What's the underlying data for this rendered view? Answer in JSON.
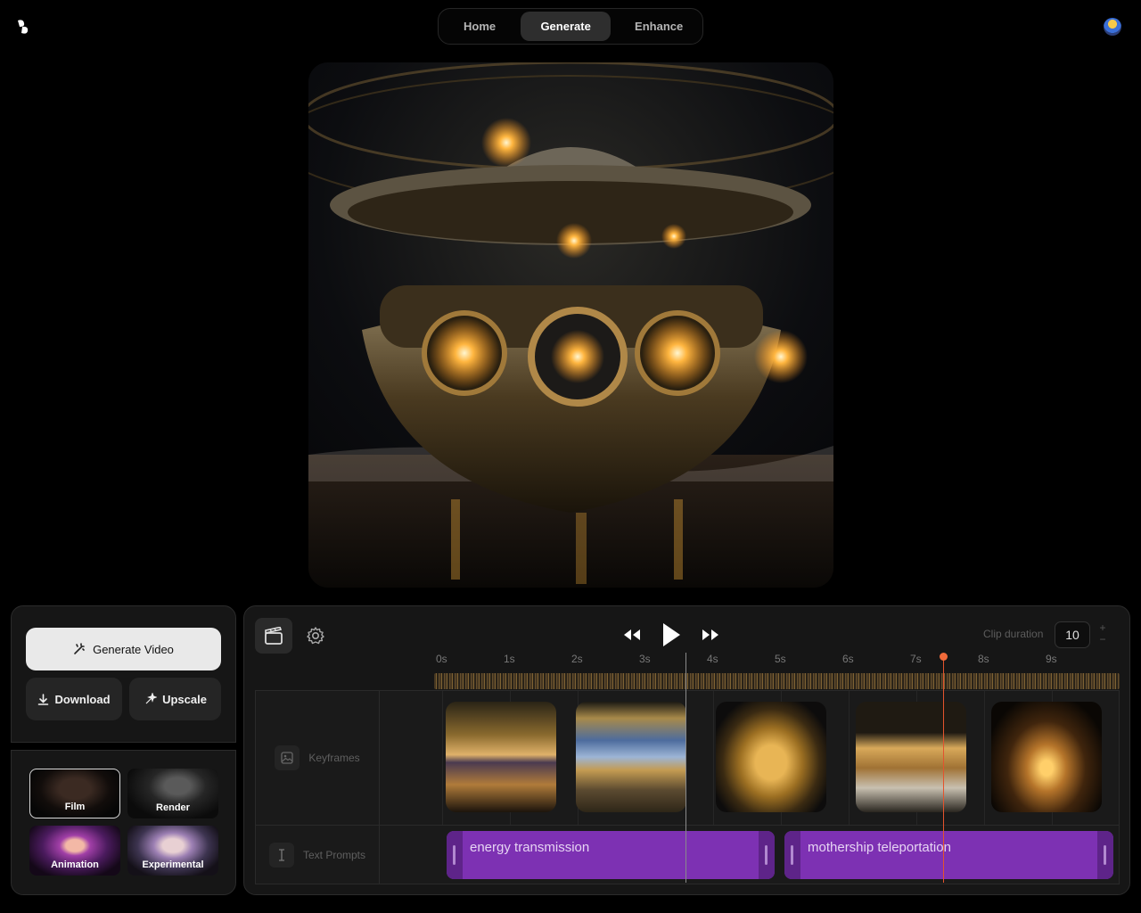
{
  "nav": {
    "tabs": [
      "Home",
      "Generate",
      "Enhance"
    ],
    "active": "Generate"
  },
  "preview": {
    "subject": "golden mothership over reflective sea"
  },
  "actions": {
    "generate_label": "Generate Video",
    "download_label": "Download",
    "upscale_label": "Upscale"
  },
  "styles": [
    {
      "label": "Film",
      "selected": true
    },
    {
      "label": "Render",
      "selected": false
    },
    {
      "label": "Animation",
      "selected": false
    },
    {
      "label": "Experimental",
      "selected": false
    }
  ],
  "timeline": {
    "clip_duration_label": "Clip duration",
    "clip_duration_value": "10",
    "stepper_plus": "+",
    "stepper_minus": "−",
    "ticks": [
      "0s",
      "1s",
      "2s",
      "3s",
      "4s",
      "5s",
      "6s",
      "7s",
      "8s",
      "9s"
    ],
    "tracks": {
      "keyframes_label": "Keyframes",
      "text_prompts_label": "Text Prompts"
    },
    "prompts": [
      "energy transmission",
      "mothership teleportation"
    ],
    "playhead_seconds": 7.4
  },
  "colors": {
    "accent_purple": "#7d31b3",
    "playhead": "#e4532d"
  }
}
